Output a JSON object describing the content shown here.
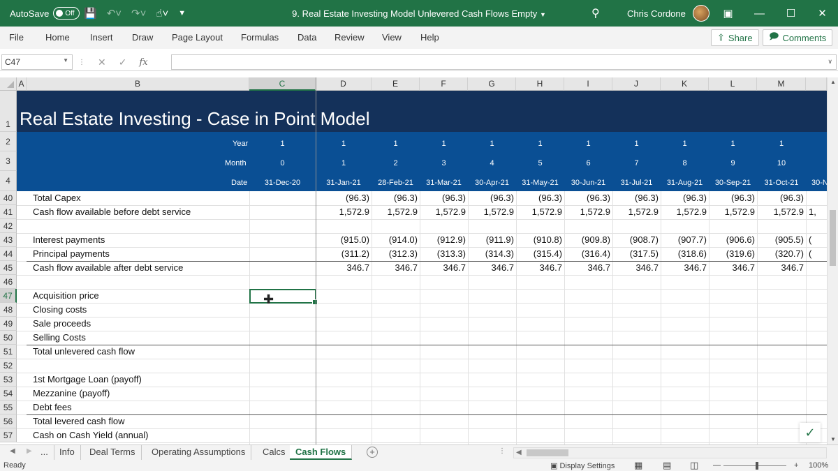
{
  "titlebar": {
    "autosave_label": "AutoSave",
    "autosave_state": "Off",
    "document_title": "9. Real Estate Investing Model Unlevered Cash Flows Empty",
    "user_name": "Chris Cordone"
  },
  "ribbon": {
    "tabs": [
      "File",
      "Home",
      "Insert",
      "Draw",
      "Page Layout",
      "Formulas",
      "Data",
      "Review",
      "View",
      "Help"
    ],
    "share_label": "Share",
    "comments_label": "Comments"
  },
  "formula_bar": {
    "name_box": "C47",
    "fx_label": "fx",
    "formula": ""
  },
  "columns": [
    "A",
    "B",
    "C",
    "D",
    "E",
    "F",
    "G",
    "H",
    "I",
    "J",
    "K",
    "L",
    "M"
  ],
  "selected_column": "C",
  "banner": {
    "title": "Real Estate Investing - Case in Point Model",
    "year_label": "Year",
    "month_label": "Month",
    "date_label": "Date",
    "year_values": [
      "1",
      "1",
      "1",
      "1",
      "1",
      "1",
      "1",
      "1",
      "1",
      "1",
      "1"
    ],
    "month_values": [
      "0",
      "1",
      "2",
      "3",
      "4",
      "5",
      "6",
      "7",
      "8",
      "9",
      "10"
    ],
    "date_values": [
      "31-Dec-20",
      "31-Jan-21",
      "28-Feb-21",
      "31-Mar-21",
      "30-Apr-21",
      "31-May-21",
      "30-Jun-21",
      "31-Jul-21",
      "31-Aug-21",
      "30-Sep-21",
      "31-Oct-21",
      "30-N"
    ]
  },
  "row_numbers": [
    "1",
    "2",
    "3",
    "4",
    "40",
    "41",
    "42",
    "43",
    "44",
    "45",
    "46",
    "47",
    "48",
    "49",
    "50",
    "51",
    "52",
    "53",
    "54",
    "55",
    "56",
    "57"
  ],
  "selected_row": "47",
  "rows": [
    {
      "label": "Total Capex",
      "values": [
        "(96.3)",
        "(96.3)",
        "(96.3)",
        "(96.3)",
        "(96.3)",
        "(96.3)",
        "(96.3)",
        "(96.3)",
        "(96.3)",
        "(96.3)"
      ],
      "overflow": ""
    },
    {
      "label": "Cash flow available before debt service",
      "values": [
        "1,572.9",
        "1,572.9",
        "1,572.9",
        "1,572.9",
        "1,572.9",
        "1,572.9",
        "1,572.9",
        "1,572.9",
        "1,572.9",
        "1,572.9"
      ],
      "overflow": "1,"
    },
    {
      "label": "",
      "values": [],
      "overflow": ""
    },
    {
      "label": "Interest payments",
      "values": [
        "(915.0)",
        "(914.0)",
        "(912.9)",
        "(911.9)",
        "(910.8)",
        "(909.8)",
        "(908.7)",
        "(907.7)",
        "(906.6)",
        "(905.5)"
      ],
      "overflow": "("
    },
    {
      "label": "Principal payments",
      "values": [
        "(311.2)",
        "(312.3)",
        "(313.3)",
        "(314.3)",
        "(315.4)",
        "(316.4)",
        "(317.5)",
        "(318.6)",
        "(319.6)",
        "(320.7)"
      ],
      "overflow": "("
    },
    {
      "label": "Cash flow available after debt service",
      "values": [
        "346.7",
        "346.7",
        "346.7",
        "346.7",
        "346.7",
        "346.7",
        "346.7",
        "346.7",
        "346.7",
        "346.7"
      ],
      "overflow": ""
    },
    {
      "label": "",
      "values": [],
      "overflow": ""
    },
    {
      "label": "Acquisition price",
      "values": [],
      "overflow": ""
    },
    {
      "label": "Closing costs",
      "values": [],
      "overflow": ""
    },
    {
      "label": "Sale proceeds",
      "values": [],
      "overflow": ""
    },
    {
      "label": "Selling Costs",
      "values": [],
      "overflow": ""
    },
    {
      "label": "Total unlevered cash flow",
      "values": [],
      "overflow": ""
    },
    {
      "label": "",
      "values": [],
      "overflow": ""
    },
    {
      "label": "1st Mortgage Loan (payoff)",
      "values": [],
      "overflow": ""
    },
    {
      "label": "Mezzanine (payoff)",
      "values": [],
      "overflow": ""
    },
    {
      "label": "Debt fees",
      "values": [],
      "overflow": ""
    },
    {
      "label": "Total levered cash flow",
      "values": [],
      "overflow": ""
    },
    {
      "label": "Cash on Cash Yield (annual)",
      "values": [],
      "overflow": ""
    }
  ],
  "sheet_tabs": {
    "more": "...",
    "tabs": [
      "Info",
      "Deal Terms",
      "Operating Assumptions",
      "Calcs",
      "Cash Flows"
    ],
    "active": "Cash Flows"
  },
  "status": {
    "ready": "Ready",
    "display_settings": "Display Settings",
    "zoom": "100%"
  }
}
